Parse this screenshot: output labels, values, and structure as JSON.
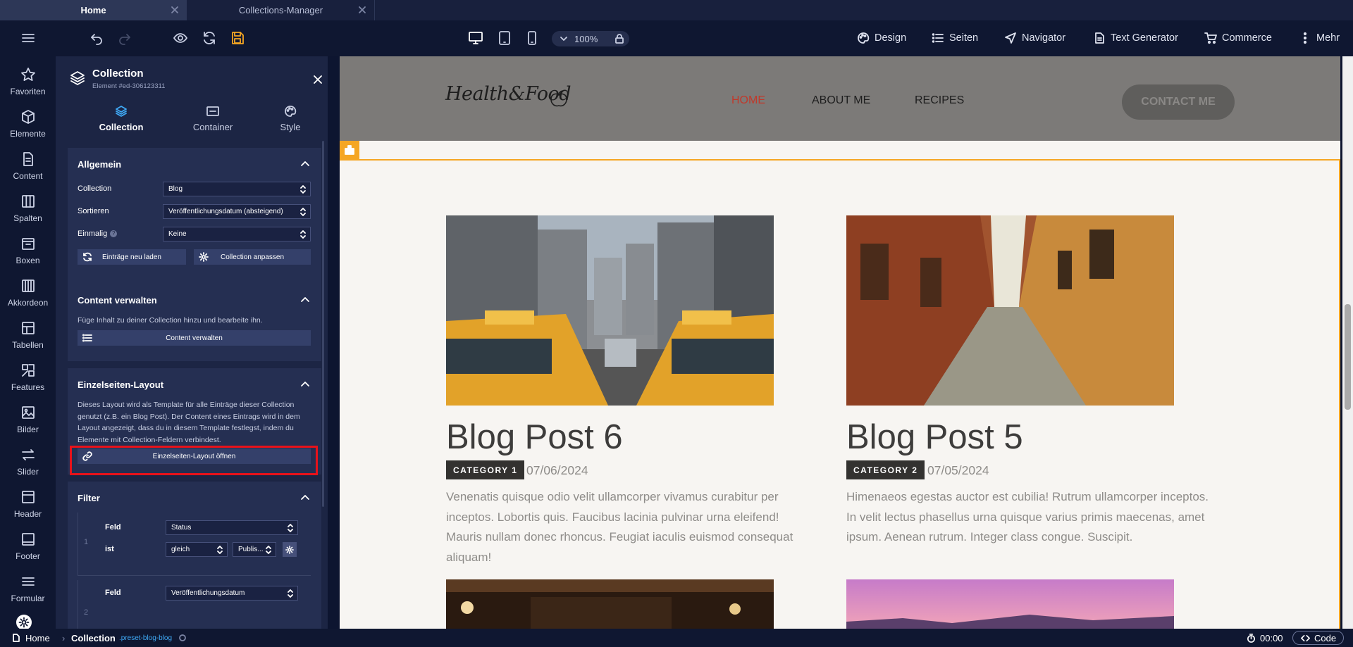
{
  "tabs": [
    {
      "label": "Home"
    },
    {
      "label": "Collections-Manager"
    }
  ],
  "toolbar": {
    "zoom": "100%"
  },
  "menu": {
    "design": "Design",
    "seiten": "Seiten",
    "navigator": "Navigator",
    "text_generator": "Text Generator",
    "commerce": "Commerce",
    "mehr": "Mehr"
  },
  "sidebar": {
    "items": [
      {
        "label": "Favoriten",
        "icon": "star-icon"
      },
      {
        "label": "Elemente",
        "icon": "cube-icon"
      },
      {
        "label": "Content",
        "icon": "file-icon"
      },
      {
        "label": "Spalten",
        "icon": "columns-icon"
      },
      {
        "label": "Boxen",
        "icon": "box-icon"
      },
      {
        "label": "Akkordeon",
        "icon": "accordion-icon"
      },
      {
        "label": "Tabellen",
        "icon": "table-icon"
      },
      {
        "label": "Features",
        "icon": "features-icon"
      },
      {
        "label": "Bilder",
        "icon": "image-icon"
      },
      {
        "label": "Slider",
        "icon": "slider-icon"
      },
      {
        "label": "Header",
        "icon": "header-icon"
      },
      {
        "label": "Footer",
        "icon": "footer-icon"
      },
      {
        "label": "Formular",
        "icon": "form-icon"
      }
    ]
  },
  "panel": {
    "title": "Collection",
    "subtitle": "Element #ed-306123311",
    "tabs": [
      {
        "label": "Collection"
      },
      {
        "label": "Container"
      },
      {
        "label": "Style"
      }
    ],
    "allgemein": {
      "title": "Allgemein",
      "collection_label": "Collection",
      "collection_value": "Blog",
      "sortieren_label": "Sortieren",
      "sortieren_value": "Veröffentlichungsdatum (absteigend)",
      "einmalig_label": "Einmalig",
      "einmalig_value": "Keine",
      "reload_button": "Einträge neu laden",
      "adjust_button": "Collection anpassen"
    },
    "content": {
      "title": "Content verwalten",
      "desc": "Füge Inhalt zu deiner Collection hinzu und bearbeite ihn.",
      "button": "Content verwalten"
    },
    "layout": {
      "title": "Einzelseiten-Layout",
      "desc": "Dieses Layout wird als Template für alle Einträge dieser Collection genutzt (z.B. ein Blog Post). Der Content eines Eintrags wird in dem Layout angezeigt, dass du in diesem Template festlegst, indem du Elemente mit Collection-Feldern verbindest.",
      "button": "Einzelseiten-Layout öffnen"
    },
    "filter": {
      "title": "Filter",
      "rows": [
        {
          "num": "1",
          "feld_label": "Feld",
          "feld_value": "Status",
          "ist_label": "ist",
          "op_value": "gleich",
          "val_value": "Publis..."
        },
        {
          "num": "2",
          "feld_label": "Feld",
          "feld_value": "Veröffentlichungsdatum"
        }
      ]
    }
  },
  "site": {
    "logo": "Health&Food",
    "nav": [
      "HOME",
      "ABOUT ME",
      "RECIPES"
    ],
    "contact": "CONTACT ME",
    "posts": [
      {
        "title": "Blog Post 6",
        "category": "CATEGORY 1",
        "date": "07/06/2024",
        "excerpt": "Venenatis quisque odio velit ullamcorper vivamus curabitur per inceptos. Lobortis quis. Faucibus lacinia pulvinar urna eleifend! Mauris nullam donec rhoncus. Feugiat iaculis euismod consequat aliquam!"
      },
      {
        "title": "Blog Post 5",
        "category": "CATEGORY 2",
        "date": "07/05/2024",
        "excerpt": "Himenaeos egestas auctor est cubilia! Rutrum ullamcorper inceptos. In velit lectus phasellus urna quisque varius primis maecenas, amet ipsum. Aenean rutrum. Integer class congue. Suscipit."
      }
    ]
  },
  "status": {
    "home": "Home",
    "element": "Collection",
    "class": ".preset-blog-blog",
    "time": "00:00",
    "code": "Code"
  },
  "colors": {
    "accent": "#f5a623",
    "highlight": "#e8121a",
    "nav_active": "#c0392b"
  }
}
